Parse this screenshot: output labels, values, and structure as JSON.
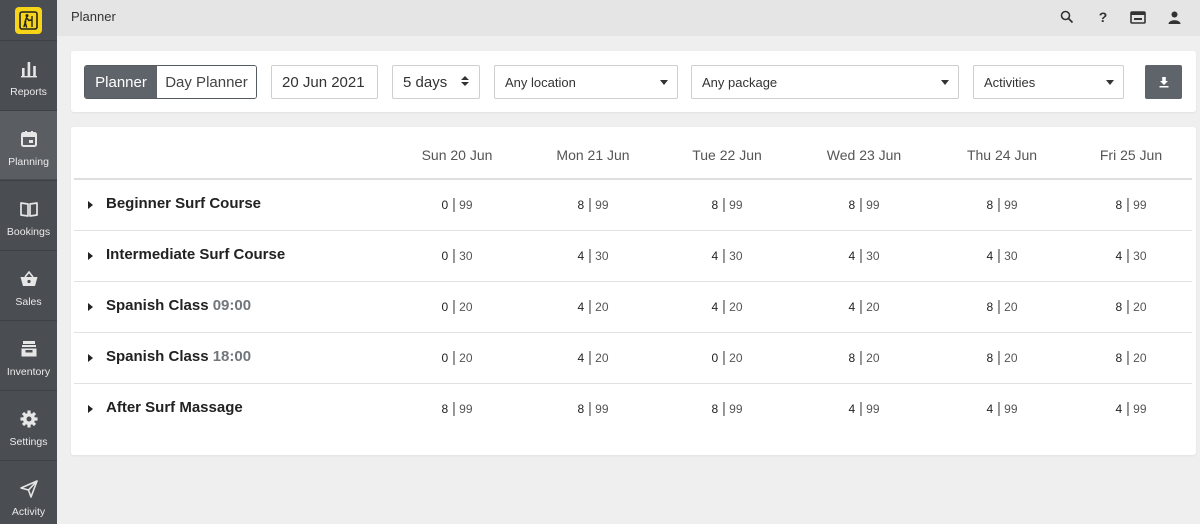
{
  "app": {
    "page_title": "Planner"
  },
  "sidebar": {
    "items": [
      {
        "label": "Reports",
        "icon": "bar-chart-icon"
      },
      {
        "label": "Planning",
        "icon": "calendar-icon"
      },
      {
        "label": "Bookings",
        "icon": "book-icon"
      },
      {
        "label": "Sales",
        "icon": "basket-icon"
      },
      {
        "label": "Inventory",
        "icon": "inbox-icon"
      },
      {
        "label": "Settings",
        "icon": "gear-icon"
      },
      {
        "label": "Activity",
        "icon": "paper-plane-icon"
      }
    ],
    "active": "Planning"
  },
  "topbar": {
    "icons": [
      "search-icon",
      "help-icon",
      "ticket-icon",
      "user-icon"
    ],
    "help_glyph": "?"
  },
  "filters": {
    "view_options": [
      "Planner",
      "Day Planner"
    ],
    "selected_view": "Planner",
    "date": "20 Jun 2021",
    "range": "5 days",
    "location": "Any location",
    "package": "Any package",
    "type": "Activities"
  },
  "table": {
    "days": [
      "Sun 20 Jun",
      "Mon 21 Jun",
      "Tue 22 Jun",
      "Wed 23 Jun",
      "Thu 24 Jun",
      "Fri 25 Jun"
    ],
    "rows": [
      {
        "name": "Beginner Surf Course",
        "time": "",
        "cells": [
          [
            "0",
            "99"
          ],
          [
            "8",
            "99"
          ],
          [
            "8",
            "99"
          ],
          [
            "8",
            "99"
          ],
          [
            "8",
            "99"
          ],
          [
            "8",
            "99"
          ]
        ]
      },
      {
        "name": "Intermediate Surf Course",
        "time": "",
        "cells": [
          [
            "0",
            "30"
          ],
          [
            "4",
            "30"
          ],
          [
            "4",
            "30"
          ],
          [
            "4",
            "30"
          ],
          [
            "4",
            "30"
          ],
          [
            "4",
            "30"
          ]
        ]
      },
      {
        "name": "Spanish Class",
        "time": "09:00",
        "cells": [
          [
            "0",
            "20"
          ],
          [
            "4",
            "20"
          ],
          [
            "4",
            "20"
          ],
          [
            "4",
            "20"
          ],
          [
            "8",
            "20"
          ],
          [
            "8",
            "20"
          ]
        ]
      },
      {
        "name": "Spanish Class",
        "time": "18:00",
        "cells": [
          [
            "0",
            "20"
          ],
          [
            "4",
            "20"
          ],
          [
            "0",
            "20"
          ],
          [
            "8",
            "20"
          ],
          [
            "8",
            "20"
          ],
          [
            "8",
            "20"
          ]
        ]
      },
      {
        "name": "After Surf Massage",
        "time": "",
        "cells": [
          [
            "8",
            "99"
          ],
          [
            "8",
            "99"
          ],
          [
            "8",
            "99"
          ],
          [
            "4",
            "99"
          ],
          [
            "4",
            "99"
          ],
          [
            "4",
            "99"
          ]
        ]
      }
    ]
  },
  "colors": {
    "sidebar": "#4a4d52",
    "accent": "#5f646a",
    "logo": "#f7d417"
  }
}
